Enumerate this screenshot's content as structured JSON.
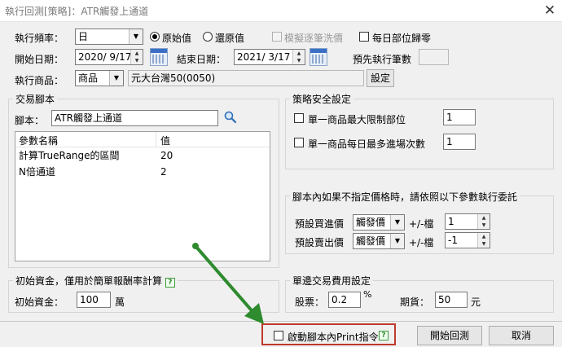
{
  "window": {
    "title": "執行回測[策略]：ATR觸發上通道"
  },
  "settings": {
    "freq_label": "執行頻率：",
    "freq_value": "日",
    "radio_original": "原始值",
    "radio_restore": "還原值",
    "simulate_label": "模擬逐筆洗價",
    "daily_reset_label": "每日部位歸零",
    "start_label": "開始日期：",
    "start_value": "2020/ 9/17",
    "end_label": "結束日期：",
    "end_value": "2021/ 3/17",
    "precount_label": "預先執行筆數",
    "precount_value": "",
    "product_label": "執行商品：",
    "product_type": "商品",
    "product_value": "元大台灣50(0050)",
    "set_button": "設定"
  },
  "script": {
    "group_title": "交易腳本",
    "script_label": "腳本：",
    "script_value": "ATR觸發上通道",
    "columns": [
      "參數名稱",
      "值"
    ],
    "params": [
      {
        "name": "計算TrueRange的區間",
        "value": "20"
      },
      {
        "name": "N倍通道",
        "value": "2"
      }
    ]
  },
  "safety": {
    "group_title": "策略安全設定",
    "max_position_label": "單一商品最大限制部位",
    "max_position_value": "1",
    "max_entries_label": "單一商品每日最多進場次數",
    "max_entries_value": "1"
  },
  "order": {
    "group_title": "腳本內如果不指定價格時，請依照以下參數執行委託",
    "buy_label": "預設買進價",
    "buy_price": "觸發價",
    "buy_tick_label": "+/-檔",
    "buy_tick": "1",
    "sell_label": "預設賣出價",
    "sell_price": "觸發價",
    "sell_tick_label": "+/-檔",
    "sell_tick": "-1"
  },
  "capital": {
    "group_title": "初始資金，僅用於簡單報酬率計算",
    "help": "?",
    "label": "初始資金：",
    "value": "100",
    "unit": "萬"
  },
  "fee": {
    "group_title": "單邊交易費用設定",
    "stock_label": "股票：",
    "stock_value": "0.2",
    "stock_unit": "%",
    "futures_label": "期貨：",
    "futures_value": "50",
    "futures_unit": "元"
  },
  "footer": {
    "print_label": "啟動腳本內Print指令",
    "help": "?",
    "start_button": "開始回測",
    "cancel_button": "取消"
  },
  "colors": {
    "annotation_arrow": "#2e8b2e",
    "highlight_box": "#c0392b"
  }
}
